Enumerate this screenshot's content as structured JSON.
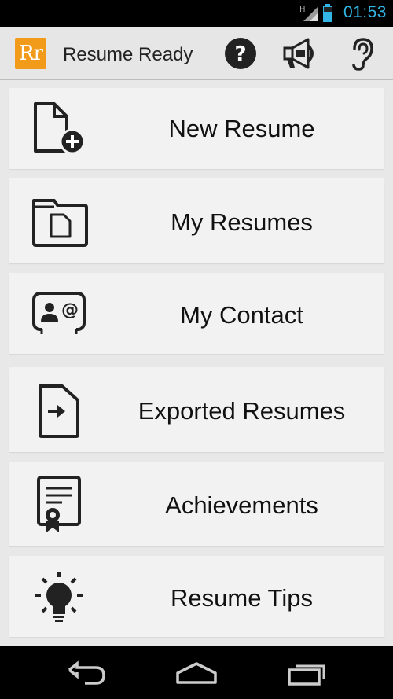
{
  "status_bar": {
    "time": "01:53",
    "network_type": "H"
  },
  "header": {
    "logo_text": "Rr",
    "title": "Resume Ready",
    "actions": [
      {
        "icon": "help-icon"
      },
      {
        "icon": "megaphone-icon"
      },
      {
        "icon": "ear-icon"
      }
    ]
  },
  "menu": {
    "items": [
      {
        "label": "New Resume",
        "icon": "new-file-icon"
      },
      {
        "label": "My Resumes",
        "icon": "folder-icon"
      },
      {
        "label": "My Contact",
        "icon": "contact-card-icon"
      },
      {
        "label": "Exported Resumes",
        "icon": "export-file-icon"
      },
      {
        "label": "Achievements",
        "icon": "certificate-icon"
      },
      {
        "label": "Resume Tips",
        "icon": "lightbulb-icon"
      }
    ]
  },
  "nav_bar": {
    "buttons": [
      "back",
      "home",
      "recent-apps"
    ]
  },
  "colors": {
    "accent": "#33b5e5",
    "logo": "#f29a1a",
    "card": "#f2f2f2",
    "background": "#e8e8e8"
  }
}
